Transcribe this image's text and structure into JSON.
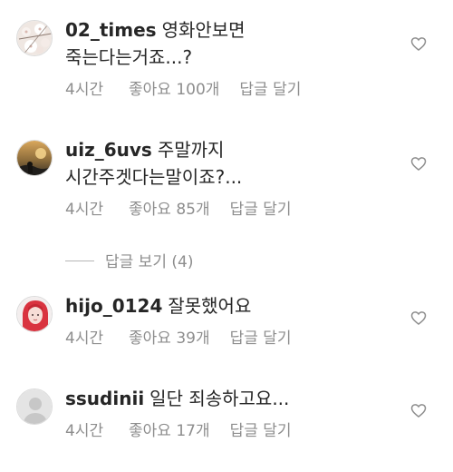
{
  "comments": [
    {
      "username": "02_times",
      "text": "영화안보면 죽는다는거죠...?",
      "time": "4시간",
      "likes": "좋아요 100개",
      "reply_label": "답글 달기",
      "avatar": "blossom-photo"
    },
    {
      "username": "uiz_6uvs",
      "text": "주말까지 시간주겟다는말이죠?...",
      "time": "4시간",
      "likes": "좋아요 85개",
      "reply_label": "답글 달기",
      "avatar": "sunset-photo"
    },
    {
      "username": "hijo_0124",
      "text": "잘못했어요",
      "time": "4시간",
      "likes": "좋아요 39개",
      "reply_label": "답글 달기",
      "avatar": "red-hair-portrait"
    },
    {
      "username": "ssudinii",
      "text": "일단 죄송하고요...",
      "time": "4시간",
      "likes": "좋아요 17개",
      "reply_label": "답글 달기",
      "avatar": "default-profile"
    }
  ],
  "view_replies": {
    "label": "답글 보기 (4)"
  },
  "colors": {
    "text": "#262626",
    "secondary": "#8e8e8e",
    "divider": "#b5b5b5"
  }
}
